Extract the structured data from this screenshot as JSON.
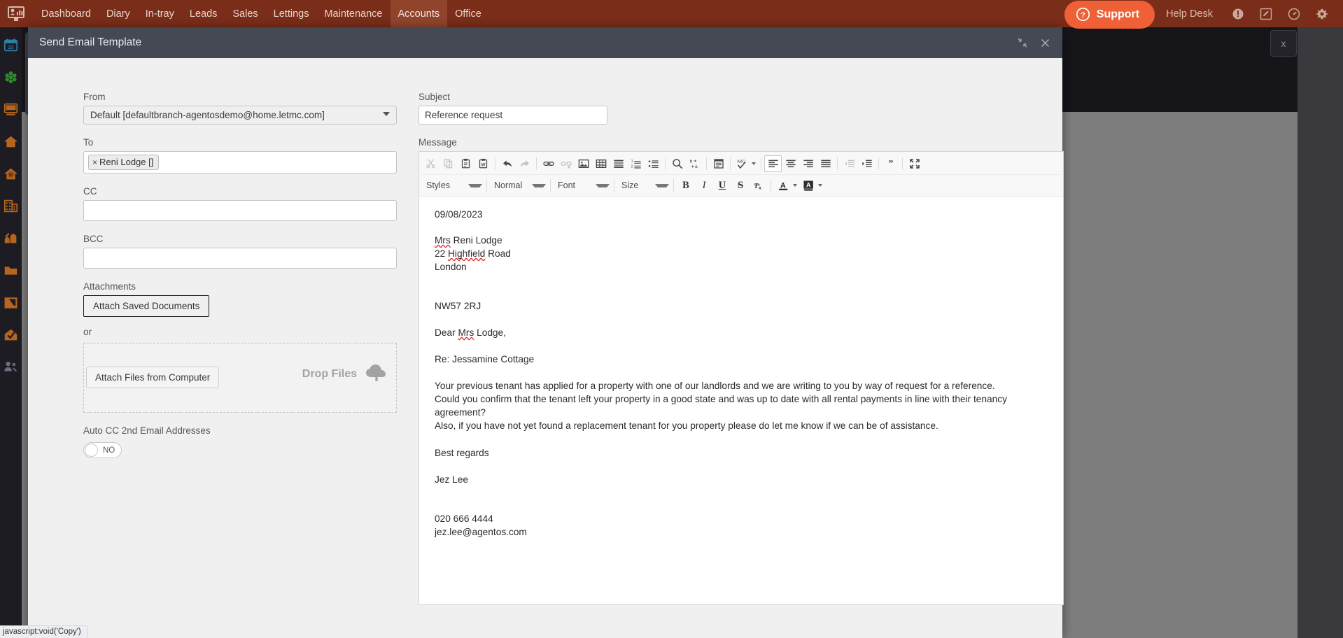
{
  "topnav": {
    "logo_icon": "monitor-chart-logo",
    "items": [
      {
        "label": "Dashboard",
        "active": false
      },
      {
        "label": "Diary",
        "active": false
      },
      {
        "label": "In-tray",
        "active": false
      },
      {
        "label": "Leads",
        "active": false
      },
      {
        "label": "Sales",
        "active": false
      },
      {
        "label": "Lettings",
        "active": false
      },
      {
        "label": "Maintenance",
        "active": false
      },
      {
        "label": "Accounts",
        "active": true
      },
      {
        "label": "Office",
        "active": false
      }
    ],
    "support_label": "Support",
    "support_icon": "question-circle-icon",
    "helpdesk_label": "Help Desk",
    "icons": [
      "alert-badge-icon",
      "edit-square-icon",
      "speedometer-icon",
      "gear-icon"
    ],
    "bar_color": "#7a2d18",
    "active_color": "#91442c",
    "support_color": "#ef6036"
  },
  "sidebar": {
    "items": [
      {
        "name": "calendar-icon",
        "color": "#2e7fa8"
      },
      {
        "name": "hexagon-cluster-icon",
        "color": "#2f8a2f"
      },
      {
        "name": "payments-screen-icon",
        "color": "#b5651d"
      },
      {
        "name": "house-icon",
        "color": "#b5651d"
      },
      {
        "name": "house-clock-icon",
        "color": "#b5651d"
      },
      {
        "name": "office-building-icon",
        "color": "#b5651d"
      },
      {
        "name": "construction-icon",
        "color": "#b5651d"
      },
      {
        "name": "folder-icon",
        "color": "#b5651d"
      },
      {
        "name": "folder-arrow-icon",
        "color": "#b5651d"
      },
      {
        "name": "house-check-icon",
        "color": "#b5651d"
      },
      {
        "name": "person-tools-icon",
        "color": "#6d6d85"
      }
    ]
  },
  "modal": {
    "title": "Send Email Template",
    "minimize_icon": "collapse-arrows-icon",
    "close_icon": "close-icon"
  },
  "form": {
    "from_label": "From",
    "from_value": "Default [defaultbranch-agentosdemo@home.letmc.com]",
    "to_label": "To",
    "to_token": "Reni Lodge []",
    "to_token_remove": "×",
    "cc_label": "CC",
    "cc_value": "",
    "cc_placeholder": "",
    "bcc_label": "BCC",
    "bcc_value": "",
    "bcc_placeholder": "",
    "attachments_label": "Attachments",
    "attach_saved_label": "Attach Saved Documents",
    "or_label": "or",
    "attach_files_label": "Attach Files from Computer",
    "drop_files_label": "Drop Files",
    "drop_cloud_icon": "cloud-upload-icon",
    "autocc_label": "Auto CC 2nd Email Addresses",
    "autocc_state": "NO"
  },
  "editor": {
    "subject_label": "Subject",
    "subject_value": "Reference request",
    "subject_placeholder": "",
    "message_label": "Message",
    "toolbar_row1": [
      {
        "name": "cut-icon",
        "glyph": "scissors",
        "state": "disabled"
      },
      {
        "name": "copy-icon",
        "glyph": "copy",
        "state": "disabled"
      },
      {
        "name": "paste-icon",
        "glyph": "clipboard",
        "state": "normal"
      },
      {
        "name": "paste-from-word-icon",
        "glyph": "clipboard-word",
        "state": "normal"
      },
      {
        "name": "separator",
        "glyph": "sep",
        "state": "sep"
      },
      {
        "name": "undo-icon",
        "glyph": "undo",
        "state": "normal"
      },
      {
        "name": "redo-icon",
        "glyph": "redo",
        "state": "disabled"
      },
      {
        "name": "separator",
        "glyph": "sep",
        "state": "sep"
      },
      {
        "name": "link-icon",
        "glyph": "link",
        "state": "normal"
      },
      {
        "name": "unlink-icon",
        "glyph": "unlink",
        "state": "disabled"
      },
      {
        "name": "image-icon",
        "glyph": "image",
        "state": "normal"
      },
      {
        "name": "table-icon",
        "glyph": "table",
        "state": "normal"
      },
      {
        "name": "horizontal-rule-icon",
        "glyph": "hrule",
        "state": "normal"
      },
      {
        "name": "numbered-list-icon",
        "glyph": "ol",
        "state": "normal"
      },
      {
        "name": "bulleted-list-icon",
        "glyph": "ul",
        "state": "normal"
      },
      {
        "name": "separator",
        "glyph": "sep",
        "state": "sep"
      },
      {
        "name": "find-icon",
        "glyph": "search",
        "state": "normal"
      },
      {
        "name": "replace-icon",
        "glyph": "replace",
        "state": "normal"
      },
      {
        "name": "separator",
        "glyph": "sep",
        "state": "sep"
      },
      {
        "name": "templates-icon",
        "glyph": "templates",
        "state": "normal"
      },
      {
        "name": "separator",
        "glyph": "sep",
        "state": "sep"
      },
      {
        "name": "spellcheck-icon",
        "glyph": "spell",
        "state": "caret"
      },
      {
        "name": "separator",
        "glyph": "sep",
        "state": "sep"
      },
      {
        "name": "align-left-icon",
        "glyph": "align-left",
        "state": "active"
      },
      {
        "name": "align-center-icon",
        "glyph": "align-center",
        "state": "normal"
      },
      {
        "name": "align-right-icon",
        "glyph": "align-right",
        "state": "normal"
      },
      {
        "name": "align-justify-icon",
        "glyph": "align-justify",
        "state": "normal"
      },
      {
        "name": "separator",
        "glyph": "sep",
        "state": "sep"
      },
      {
        "name": "outdent-icon",
        "glyph": "outdent",
        "state": "disabled"
      },
      {
        "name": "indent-icon",
        "glyph": "indent",
        "state": "normal"
      },
      {
        "name": "separator",
        "glyph": "sep",
        "state": "sep"
      },
      {
        "name": "blockquote-icon",
        "glyph": "quote",
        "state": "normal"
      },
      {
        "name": "separator",
        "glyph": "sep",
        "state": "sep"
      },
      {
        "name": "maximize-icon",
        "glyph": "maximize",
        "state": "normal"
      }
    ],
    "combos": [
      {
        "name": "styles-combo",
        "label": "Styles"
      },
      {
        "name": "paragraph-format-combo",
        "label": "Normal"
      },
      {
        "name": "font-combo",
        "label": "Font"
      },
      {
        "name": "font-size-combo",
        "label": "Size"
      }
    ],
    "format_buttons": [
      {
        "name": "bold-button",
        "label": "B",
        "style": "bold"
      },
      {
        "name": "italic-button",
        "label": "I",
        "style": "italic"
      },
      {
        "name": "underline-button",
        "label": "U",
        "style": "underline"
      },
      {
        "name": "strikethrough-button",
        "label": "S",
        "style": "strike"
      },
      {
        "name": "remove-format-button",
        "label": "Tx",
        "style": "removeformat"
      }
    ],
    "color_buttons": [
      {
        "name": "text-color-button",
        "label": "A"
      },
      {
        "name": "background-color-button",
        "label": "A"
      }
    ]
  },
  "message": {
    "date": "09/08/2023",
    "recipient_name_prefix": "Mrs",
    "recipient_name": " Reni Lodge",
    "address_line1_a": "22 ",
    "address_line1_b": "Highfield",
    "address_line1_c": " Road",
    "address_line2": "London",
    "postcode": "NW57 2RJ",
    "salutation_pre": "Dear ",
    "salutation_title": "Mrs",
    "salutation_post": " Lodge,",
    "re_line": "Re: Jessamine Cottage",
    "body_line1": "Your previous tenant has applied for a property with one of our landlords and we are writing to you by way of request for a reference.",
    "body_line2": "Could you confirm that the tenant left your property in a good state and was up to date with all rental payments in line with their tenancy agreement?",
    "body_line3": "Also, if you have not yet found a replacement tenant for you property please do let me know if we can be of assistance.",
    "signoff": "Best regards",
    "sender_name": "Jez Lee",
    "phone": "020 666 4444",
    "email": "jez.lee@agentos.com"
  },
  "statusbar": {
    "text": "javascript:void('Copy')"
  },
  "behind": {
    "close_label": "x"
  }
}
